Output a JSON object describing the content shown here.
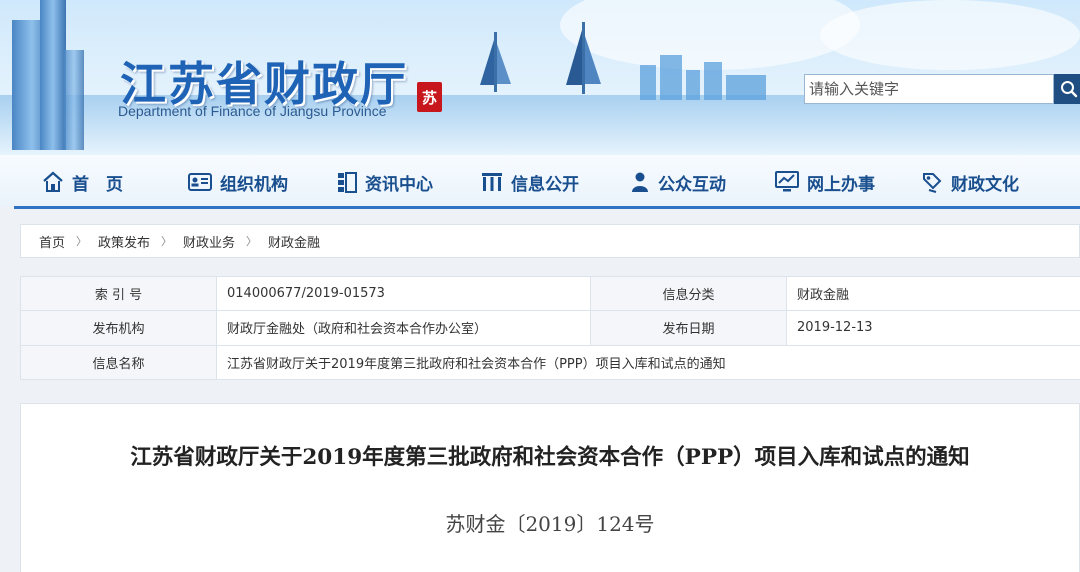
{
  "header": {
    "site_name": "江苏省财政厅",
    "site_name_en": "Department of Finance of Jiangsu Province",
    "seal_text": "苏",
    "search_placeholder": "请输入关键字"
  },
  "nav": {
    "items": [
      {
        "label": "首　页",
        "icon": "home-icon"
      },
      {
        "label": "组织机构",
        "icon": "id-card-icon"
      },
      {
        "label": "资讯中心",
        "icon": "news-icon"
      },
      {
        "label": "信息公开",
        "icon": "columns-icon"
      },
      {
        "label": "公众互动",
        "icon": "user-icon"
      },
      {
        "label": "网上办事",
        "icon": "monitor-chart-icon"
      },
      {
        "label": "财政文化",
        "icon": "culture-icon"
      }
    ]
  },
  "breadcrumb": [
    "首页",
    "政策发布",
    "财政业务",
    "财政金融"
  ],
  "info": {
    "index_label": "索 引 号",
    "index_value": "014000677/2019-01573",
    "category_label": "信息分类",
    "category_value": "财政金融",
    "publisher_label": "发布机构",
    "publisher_value": "财政厅金融处（政府和社会资本合作办公室）",
    "date_label": "发布日期",
    "date_value": "2019-12-13",
    "name_label": "信息名称",
    "name_value": "江苏省财政厅关于2019年度第三批政府和社会资本合作（PPP）项目入库和试点的通知"
  },
  "article": {
    "title": "江苏省财政厅关于2019年度第三批政府和社会资本合作（PPP）项目入库和试点的通知",
    "doc_number": "苏财金〔2019〕124号"
  },
  "colors": {
    "brand_blue": "#1f63b6",
    "nav_line": "#2e73c4",
    "seal_red": "#c8161d"
  }
}
